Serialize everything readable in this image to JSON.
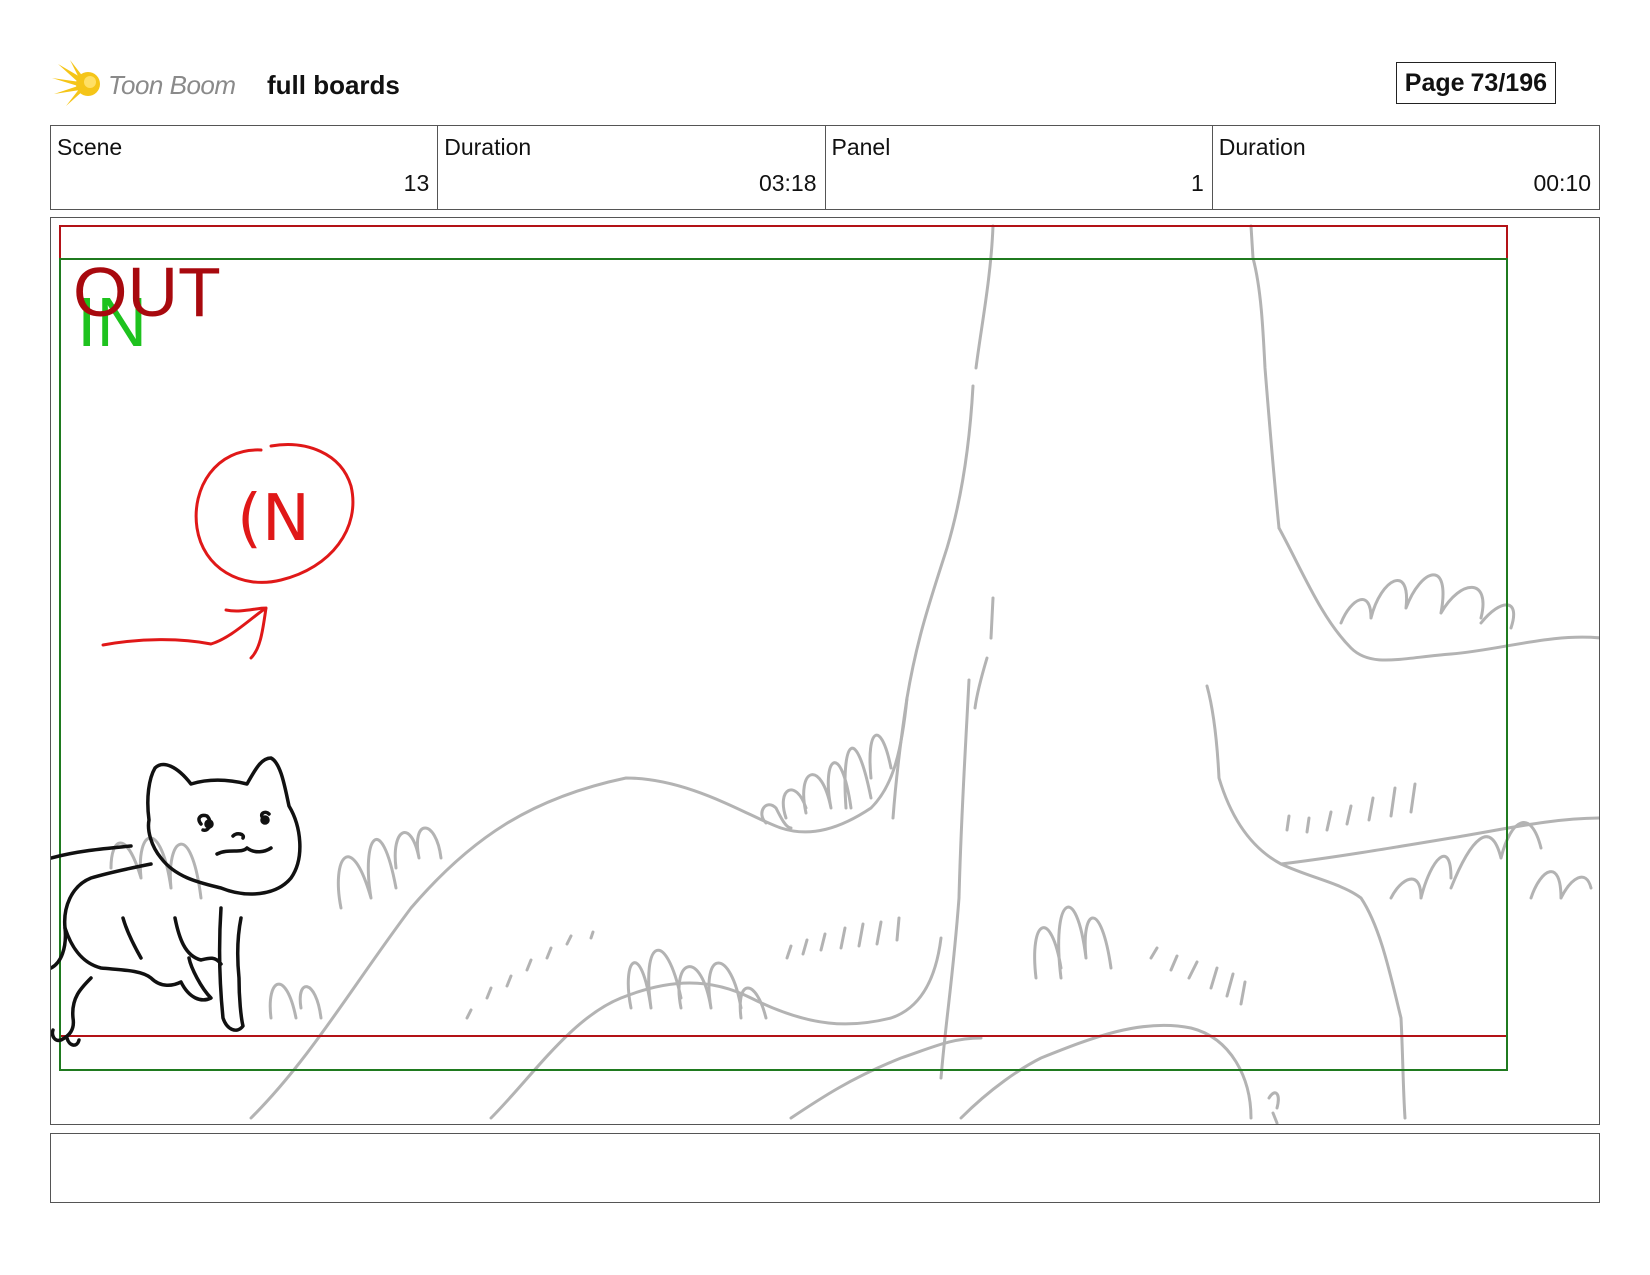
{
  "header": {
    "logo_text": "Toon Boom",
    "board_title": "full boards",
    "page_label": "Page",
    "page_value": "73/196"
  },
  "info": {
    "scene_label": "Scene",
    "scene_value": "13",
    "scene_duration_label": "Duration",
    "scene_duration_value": "03:18",
    "panel_label": "Panel",
    "panel_value": "1",
    "panel_duration_label": "Duration",
    "panel_duration_value": "00:10"
  },
  "panel": {
    "frame_out_label": "OUT",
    "frame_in_label": "IN",
    "sketch_note": "(N",
    "colors": {
      "out_frame": "#b31217",
      "in_frame": "#1f7a1f",
      "in_text": "#1ec21e",
      "out_text": "#a8090e",
      "sketch_red": "#e01818",
      "background_sketch": "#b3b3b3",
      "character": "#111111"
    }
  },
  "caption": {
    "text": ""
  },
  "icons": {
    "logo": "toon-boom-star-icon"
  }
}
